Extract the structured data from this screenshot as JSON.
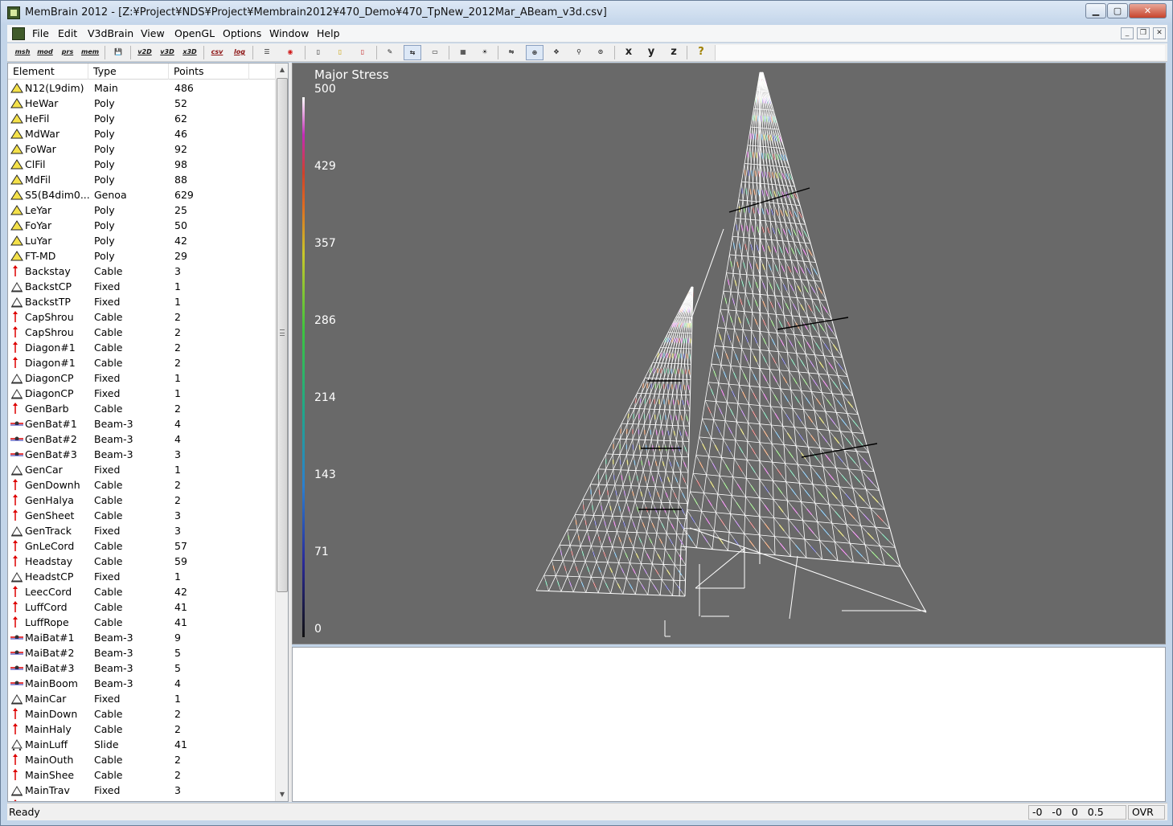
{
  "window": {
    "title": "MemBrain 2012 - [Z:¥Project¥NDS¥Project¥Membrain2012¥470_Demo¥470_TpNew_2012Mar_ABeam_v3d.csv]",
    "min_label": "▁",
    "max_label": "▢",
    "close_label": "✕"
  },
  "menubar": {
    "items": [
      "File",
      "Edit",
      "V3dBrain",
      "View",
      "OpenGL",
      "Options",
      "Window",
      "Help"
    ],
    "mdi_min": "_",
    "mdi_restore": "❐",
    "mdi_close": "✕"
  },
  "toolbar": {
    "buttons": [
      {
        "name": "msh-button",
        "label": "msh",
        "kind": "txt"
      },
      {
        "name": "mod-button",
        "label": "mod",
        "kind": "txt"
      },
      {
        "name": "prs-button",
        "label": "prs",
        "kind": "txt"
      },
      {
        "name": "mem-button",
        "label": "mem",
        "kind": "txt"
      },
      {
        "name": "save-button",
        "label": "💾",
        "kind": "icon"
      },
      {
        "name": "v2d-button",
        "label": "v2D",
        "kind": "txt"
      },
      {
        "name": "v3d-button",
        "label": "v3D",
        "kind": "txt"
      },
      {
        "name": "x3d-button",
        "label": "x3D",
        "kind": "txt"
      },
      {
        "name": "csv-button",
        "label": "csv",
        "kind": "txt"
      },
      {
        "name": "log-button",
        "label": "log",
        "kind": "txt"
      },
      {
        "name": "list-button",
        "label": "☰",
        "kind": "icon"
      },
      {
        "name": "target-button",
        "label": "◉",
        "kind": "icon"
      },
      {
        "name": "bar-button",
        "label": "▯",
        "kind": "icon"
      },
      {
        "name": "bar-yellow-button",
        "label": "▯",
        "kind": "icon"
      },
      {
        "name": "bar-red-button",
        "label": "▯",
        "kind": "icon"
      },
      {
        "name": "edit-button",
        "label": "✎",
        "kind": "icon"
      },
      {
        "name": "flip-button",
        "label": "⇆",
        "kind": "icon"
      },
      {
        "name": "page-button",
        "label": "▭",
        "kind": "icon"
      },
      {
        "name": "grid-button",
        "label": "▦",
        "kind": "icon"
      },
      {
        "name": "light-button",
        "label": "☀",
        "kind": "icon"
      },
      {
        "name": "mirror-button",
        "label": "⇋",
        "kind": "icon"
      },
      {
        "name": "rotate-button",
        "label": "⊕",
        "kind": "icon"
      },
      {
        "name": "pan-button",
        "label": "✥",
        "kind": "icon"
      },
      {
        "name": "zoom-button",
        "label": "⚲",
        "kind": "icon"
      },
      {
        "name": "zoom-fit-button",
        "label": "⊙",
        "kind": "icon"
      },
      {
        "name": "view-x-button",
        "label": "x",
        "kind": "axis"
      },
      {
        "name": "view-y-button",
        "label": "y",
        "kind": "axis"
      },
      {
        "name": "view-z-button",
        "label": "z",
        "kind": "axis"
      },
      {
        "name": "help-button",
        "label": "?",
        "kind": "axis"
      }
    ]
  },
  "list": {
    "headers": {
      "element": "Element",
      "type": "Type",
      "points": "Points"
    },
    "rows": [
      {
        "element": "N12(L9dim)",
        "type": "Main",
        "points": "486",
        "icon": "triangle-yellow"
      },
      {
        "element": "HeWar",
        "type": "Poly",
        "points": "52",
        "icon": "triangle-yellow"
      },
      {
        "element": "HeFil",
        "type": "Poly",
        "points": "62",
        "icon": "triangle-yellow"
      },
      {
        "element": "MdWar",
        "type": "Poly",
        "points": "46",
        "icon": "triangle-yellow"
      },
      {
        "element": "FoWar",
        "type": "Poly",
        "points": "92",
        "icon": "triangle-yellow"
      },
      {
        "element": "ClFil",
        "type": "Poly",
        "points": "98",
        "icon": "triangle-yellow"
      },
      {
        "element": "MdFil",
        "type": "Poly",
        "points": "88",
        "icon": "triangle-yellow"
      },
      {
        "element": "S5(B4dim0...",
        "type": "Genoa",
        "points": "629",
        "icon": "triangle-yellow"
      },
      {
        "element": "LeYar",
        "type": "Poly",
        "points": "25",
        "icon": "triangle-yellow"
      },
      {
        "element": "FoYar",
        "type": "Poly",
        "points": "50",
        "icon": "triangle-yellow"
      },
      {
        "element": "LuYar",
        "type": "Poly",
        "points": "42",
        "icon": "triangle-yellow"
      },
      {
        "element": "FT-MD",
        "type": "Poly",
        "points": "29",
        "icon": "triangle-yellow"
      },
      {
        "element": "Backstay",
        "type": "Cable",
        "points": "3",
        "icon": "cable"
      },
      {
        "element": "BackstCP",
        "type": "Fixed",
        "points": "1",
        "icon": "fixed"
      },
      {
        "element": "BackstTP",
        "type": "Fixed",
        "points": "1",
        "icon": "fixed"
      },
      {
        "element": "CapShrou",
        "type": "Cable",
        "points": "2",
        "icon": "cable"
      },
      {
        "element": "CapShrou",
        "type": "Cable",
        "points": "2",
        "icon": "cable"
      },
      {
        "element": "Diagon#1",
        "type": "Cable",
        "points": "2",
        "icon": "cable"
      },
      {
        "element": "Diagon#1",
        "type": "Cable",
        "points": "2",
        "icon": "cable"
      },
      {
        "element": "DiagonCP",
        "type": "Fixed",
        "points": "1",
        "icon": "fixed"
      },
      {
        "element": "DiagonCP",
        "type": "Fixed",
        "points": "1",
        "icon": "fixed"
      },
      {
        "element": "GenBarb",
        "type": "Cable",
        "points": "2",
        "icon": "cable"
      },
      {
        "element": "GenBat#1",
        "type": "Beam-3",
        "points": "4",
        "icon": "beam"
      },
      {
        "element": "GenBat#2",
        "type": "Beam-3",
        "points": "4",
        "icon": "beam"
      },
      {
        "element": "GenBat#3",
        "type": "Beam-3",
        "points": "3",
        "icon": "beam"
      },
      {
        "element": "GenCar",
        "type": "Fixed",
        "points": "1",
        "icon": "fixed"
      },
      {
        "element": "GenDownh",
        "type": "Cable",
        "points": "2",
        "icon": "cable"
      },
      {
        "element": "GenHalya",
        "type": "Cable",
        "points": "2",
        "icon": "cable"
      },
      {
        "element": "GenSheet",
        "type": "Cable",
        "points": "3",
        "icon": "cable"
      },
      {
        "element": "GenTrack",
        "type": "Fixed",
        "points": "3",
        "icon": "fixed"
      },
      {
        "element": "GnLeCord",
        "type": "Cable",
        "points": "57",
        "icon": "cable"
      },
      {
        "element": "Headstay",
        "type": "Cable",
        "points": "59",
        "icon": "cable"
      },
      {
        "element": "HeadstCP",
        "type": "Fixed",
        "points": "1",
        "icon": "fixed"
      },
      {
        "element": "LeecCord",
        "type": "Cable",
        "points": "42",
        "icon": "cable"
      },
      {
        "element": "LuffCord",
        "type": "Cable",
        "points": "41",
        "icon": "cable"
      },
      {
        "element": "LuffRope",
        "type": "Cable",
        "points": "41",
        "icon": "cable"
      },
      {
        "element": "MaiBat#1",
        "type": "Beam-3",
        "points": "9",
        "icon": "beam"
      },
      {
        "element": "MaiBat#2",
        "type": "Beam-3",
        "points": "5",
        "icon": "beam"
      },
      {
        "element": "MaiBat#3",
        "type": "Beam-3",
        "points": "5",
        "icon": "beam"
      },
      {
        "element": "MainBoom",
        "type": "Beam-3",
        "points": "4",
        "icon": "beam"
      },
      {
        "element": "MainCar",
        "type": "Fixed",
        "points": "1",
        "icon": "fixed"
      },
      {
        "element": "MainDown",
        "type": "Cable",
        "points": "2",
        "icon": "cable"
      },
      {
        "element": "MainHaly",
        "type": "Cable",
        "points": "2",
        "icon": "cable"
      },
      {
        "element": "MainLuff",
        "type": "Slide",
        "points": "41",
        "icon": "slide"
      },
      {
        "element": "MainOuth",
        "type": "Cable",
        "points": "2",
        "icon": "cable"
      },
      {
        "element": "MainShee",
        "type": "Cable",
        "points": "2",
        "icon": "cable"
      },
      {
        "element": "MainTrav",
        "type": "Fixed",
        "points": "3",
        "icon": "fixed"
      }
    ]
  },
  "viewport": {
    "title": "Major Stress",
    "legend_ticks": [
      "500",
      "429",
      "357",
      "286",
      "214",
      "143",
      "71",
      "0"
    ],
    "background": "#696969"
  },
  "statusbar": {
    "text": "Ready",
    "coords": "-0 -0 0 0.5",
    "ovr": "OVR"
  }
}
